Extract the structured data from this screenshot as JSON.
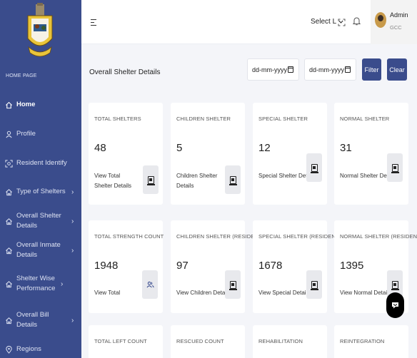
{
  "sidebar": {
    "section_label": "HOME PAGE",
    "items": [
      {
        "label": "Home",
        "icon": "home-icon",
        "chevron": false
      },
      {
        "label": "Profile",
        "icon": "user-icon",
        "chevron": false
      },
      {
        "label": "Resident Identify",
        "icon": "scan-face-icon",
        "chevron": false
      },
      {
        "label": "Type of Shelters",
        "icon": "house-icon",
        "chevron": true
      },
      {
        "label": "Overall Shelter Details",
        "icon": "house-icon",
        "chevron": true
      },
      {
        "label": "Overall Inmate Details",
        "icon": "house-icon",
        "chevron": true
      },
      {
        "label": "Shelter Wise Performance",
        "icon": "house-icon",
        "chevron": true
      },
      {
        "label": "Overall Bill Details",
        "icon": "house-icon",
        "chevron": true
      },
      {
        "label": "Regions",
        "icon": "location-icon",
        "chevron": false
      }
    ],
    "chevron_glyph": "›"
  },
  "header": {
    "language_select": "Select L",
    "user_name": "Admin",
    "user_role": "GCC"
  },
  "toolbar": {
    "title": "Overall Shelter Details",
    "from_date_placeholder": "dd-mm-yyyy",
    "to_date_placeholder": "dd-mm-yyyy",
    "filter_label": "Filter",
    "clear_label": "Clear"
  },
  "cards": [
    {
      "title": "TOTAL SHELTERS",
      "value": "48",
      "link": "View Total Shelter Details",
      "icon": "document-icon"
    },
    {
      "title": "CHILDREN SHELTER",
      "value": "5",
      "link": "Children Shelter Details",
      "icon": "document-icon"
    },
    {
      "title": "SPECIAL SHELTER",
      "value": "12",
      "link": "Special Shelter Details",
      "icon": "document-icon"
    },
    {
      "title": "NORMAL SHELTER",
      "value": "31",
      "link": "Normal Shelter Details",
      "icon": "document-icon"
    },
    {
      "title": "TOTAL STRENGTH COUNT",
      "value": "1948",
      "link": "View Total",
      "icon": "users-icon"
    },
    {
      "title": "CHILDREN SHELTER (RESIDEN...",
      "value": "97",
      "link": "View Children Details",
      "icon": "document-icon"
    },
    {
      "title": "SPECIAL SHELTER (RESIDENT ...",
      "value": "1678",
      "link": "View Special Details",
      "icon": "document-icon"
    },
    {
      "title": "NORMAL SHELTER (RESIDENT ...",
      "value": "1395",
      "link": "View Normal Details",
      "icon": "document-icon"
    },
    {
      "title": "TOTAL LEFT COUNT"
    },
    {
      "title": "RESCUED COUNT"
    },
    {
      "title": "REHABILITATION"
    },
    {
      "title": "REINTEGRATION"
    }
  ],
  "colors": {
    "primary": "#3a4c8c",
    "background": "#f4f5f9"
  }
}
